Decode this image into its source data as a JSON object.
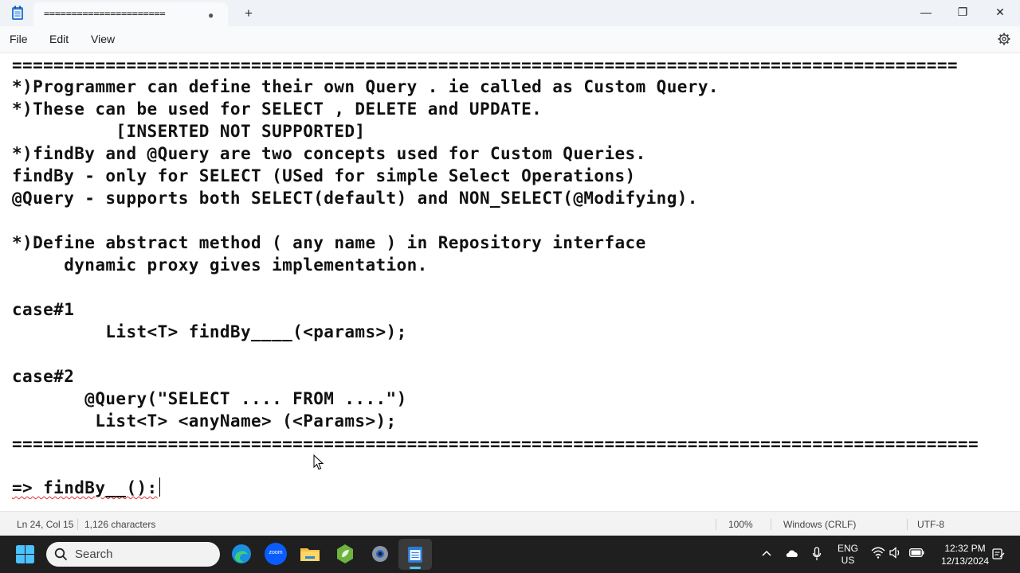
{
  "tab": {
    "title": "======================",
    "modified_dot": "●",
    "new_tab": "+"
  },
  "window": {
    "minimize": "—",
    "maximize": "❐",
    "close": "✕"
  },
  "menu": {
    "file": "File",
    "edit": "Edit",
    "view": "View",
    "settings_icon": "gear-icon"
  },
  "editor": {
    "lines": [
      "===========================================================================================",
      "*)Programmer can define their own Query . ie called as Custom Query.",
      "*)These can be used for SELECT , DELETE and UPDATE.",
      "          [INSERTED NOT SUPPORTED]",
      "*)findBy and @Query are two concepts used for Custom Queries.",
      "findBy - only for SELECT (USed for simple Select Operations)",
      "@Query - supports both SELECT(default) and NON_SELECT(@Modifying).",
      "",
      "*)Define abstract method ( any name ) in Repository interface",
      "     dynamic proxy gives implementation.",
      "",
      "case#1",
      "         List<T> findBy____(<params>);",
      "",
      "case#2",
      "       @Query(\"SELECT .... FROM ....\")",
      "        List<T> <anyName> (<Params>);",
      "=============================================================================================",
      "",
      "=> findBy__():"
    ]
  },
  "status": {
    "position": "Ln 24, Col 15",
    "characters": "1,126 characters",
    "zoom": "100%",
    "line_ending": "Windows (CRLF)",
    "encoding": "UTF-8"
  },
  "taskbar": {
    "search_placeholder": "Search",
    "zoom_label": "zoom",
    "lang_top": "ENG",
    "lang_bottom": "US",
    "time": "12:32 PM",
    "date": "12/13/2024"
  }
}
